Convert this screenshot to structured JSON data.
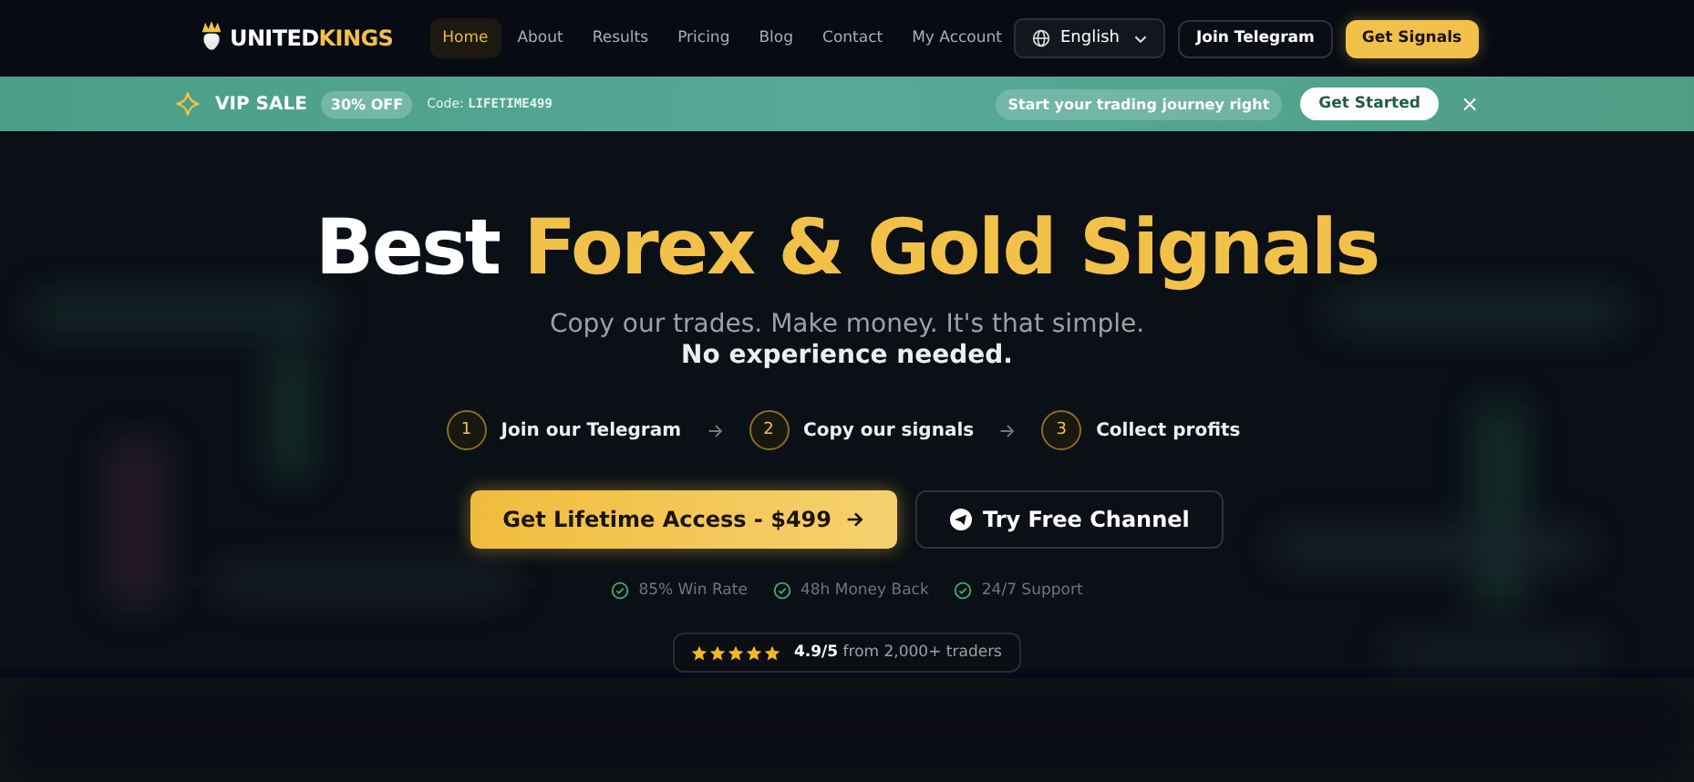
{
  "brand": {
    "first": "UNITED",
    "second": "KINGS"
  },
  "nav": [
    {
      "label": "Home",
      "selected": true
    },
    {
      "label": "About",
      "selected": false
    },
    {
      "label": "Results",
      "selected": false
    },
    {
      "label": "Pricing",
      "selected": false
    },
    {
      "label": "Blog",
      "selected": false
    },
    {
      "label": "Contact",
      "selected": false
    },
    {
      "label": "My Account",
      "selected": false
    }
  ],
  "language": "English",
  "header_buttons": [
    "Join Telegram",
    "Get Signals"
  ],
  "banner": {
    "title": "VIP SALE",
    "badge": "30% OFF",
    "code_label": "Code:",
    "code": "LIFETIME499",
    "message": "Start your trading journey right",
    "button": "Get Started",
    "close": "×"
  },
  "hero": {
    "title_plain": "Best",
    "title_accent": "Forex & Gold Signals",
    "subtitle": "Copy our trades. Make money. It's that simple.",
    "subtitle_strong": "No experience needed.",
    "steps": [
      {
        "number": "1",
        "label": "Join our Telegram"
      },
      {
        "number": "2",
        "label": "Copy our signals"
      },
      {
        "number": "3",
        "label": "Collect profits"
      }
    ],
    "primary_button": "Get Lifetime Access - $499",
    "secondary_button": "Try Free Channel",
    "features": [
      "85% Win Rate",
      "48h Money Back",
      "24/7 Support"
    ],
    "rating": {
      "stars": 5,
      "text": "**4.9/5** from 2,000+ traders"
    }
  }
}
